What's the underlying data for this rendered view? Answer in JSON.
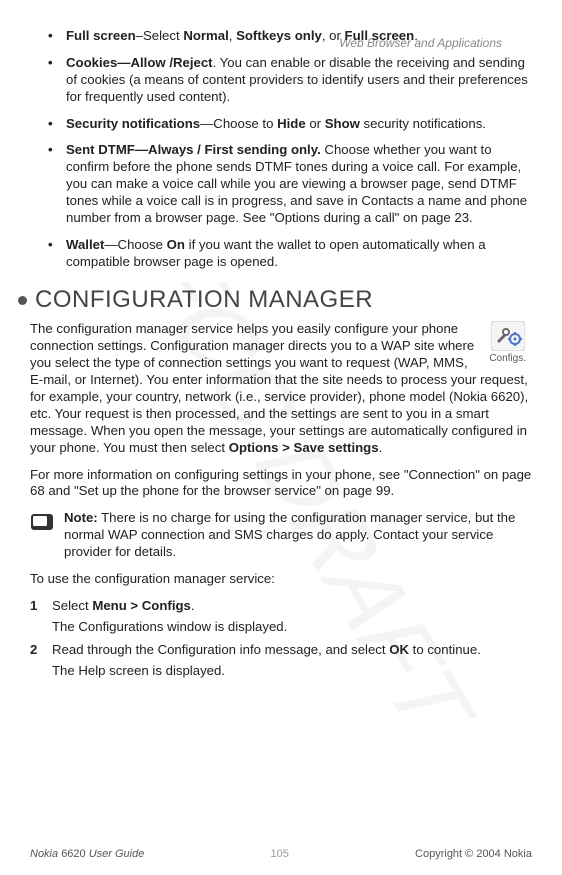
{
  "header": {
    "section": "Web Browser and Applications"
  },
  "bullets": [
    {
      "label": "Full screen",
      "sep": "–",
      "rest_a": "Select ",
      "opt1": "Normal",
      "mid1": ", ",
      "opt2": "Softkeys only",
      "mid2": ", or ",
      "opt3": "Full screen",
      "end": "."
    },
    {
      "label": "Cookies—Allow /Reject",
      "rest": ". You can enable or disable the receiving and sending of cookies (a means of content providers to identify users and their preferences for frequently used content)."
    },
    {
      "label": "Security notifications",
      "dash": "—Choose to ",
      "opt1": "Hide",
      "mid1": " or ",
      "opt2": "Show",
      "end": " security notifications."
    },
    {
      "label": "Sent DTMF—Always / First sending only.",
      "rest": " Choose whether you want to confirm before the phone sends DTMF tones during a voice call. For example, you can make a voice call while you are viewing a browser page, send DTMF tones while a voice call is in progress, and save in Contacts a name and phone number from a browser page. See \"Options during a call\" on page 23."
    },
    {
      "label": "Wallet",
      "dash": "—Choose ",
      "opt1": "On",
      "end": " if you want the wallet to open automatically when a compatible browser page is opened."
    }
  ],
  "section": {
    "title": "CONFIGURATION MANAGER"
  },
  "configs_icon_label": "Configs.",
  "para1_a": "The configuration manager service helps you easily configure your phone connection settings. Configuration manager directs you to a WAP site where you select the type of connection settings you want to request (WAP, MMS, E-mail, or Internet). You enter information that the site needs to process your request, for example, your country, network (i.e., service provider), phone model (Nokia 6620), etc. Your request is then processed, and the settings are sent to you in a smart message. When you open the message, your settings are automatically configured in your phone. You must then select ",
  "para1_b": "Options > Save settings",
  "para1_c": ".",
  "para2": "For more information on configuring settings in your phone, see \"Connection\" on page 68 and \"Set up the phone for the browser service\" on page 99.",
  "note": {
    "label": "Note:",
    "text": " There is no charge for using the configuration manager service, but the normal WAP connection and SMS charges do apply. Contact your service provider for details."
  },
  "intro_steps": "To use the configuration manager service:",
  "steps": [
    {
      "num": "1",
      "pre": "Select ",
      "bold": "Menu > Configs",
      "post": ".",
      "sub": "The Configurations window is displayed."
    },
    {
      "num": "2",
      "pre": "Read through the Configuration info message, and select ",
      "bold": "OK",
      "post": " to continue.",
      "sub": "The Help screen is displayed."
    }
  ],
  "footer": {
    "left_a": "Nokia ",
    "left_b": "6620 ",
    "left_c": "User Guide",
    "page": "105",
    "right": "Copyright © 2004 Nokia"
  },
  "watermark": "FCC DRAFT"
}
